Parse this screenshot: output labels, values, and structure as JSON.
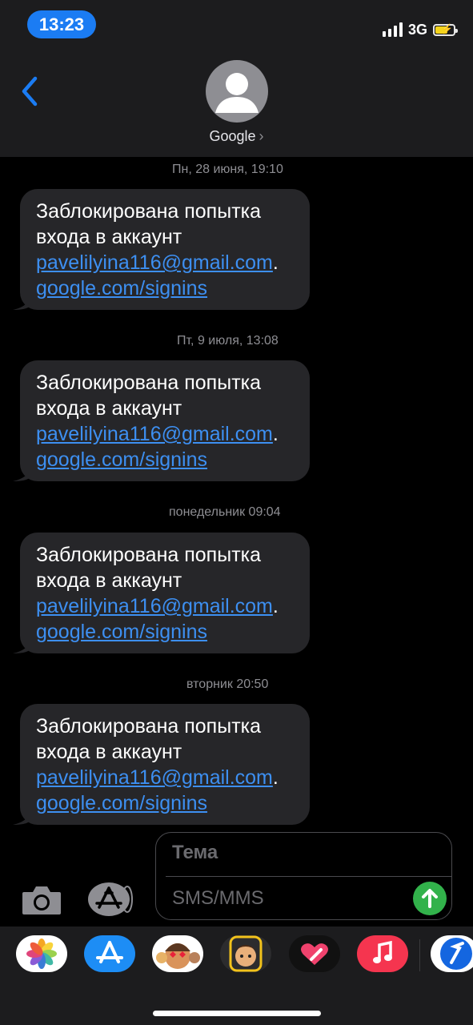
{
  "status": {
    "time": "13:23",
    "network": "3G"
  },
  "contact": {
    "name": "Google"
  },
  "messages": [
    {
      "timestamp": "Пн, 28 июня, 19:10",
      "line1": "Заблокирована попытка",
      "line2": "входа в аккаунт",
      "email": "pavelilyina116@gmail.com",
      "dot": ".",
      "link": "google.com/signins"
    },
    {
      "timestamp": "Пт, 9 июля, 13:08",
      "line1": "Заблокирована попытка",
      "line2": "входа в аккаунт",
      "email": "pavelilyina116@gmail.com",
      "dot": ".",
      "link": "google.com/signins"
    },
    {
      "timestamp": "понедельник 09:04",
      "line1": "Заблокирована попытка",
      "line2": "входа в аккаунт",
      "email": "pavelilyina116@gmail.com",
      "dot": ".",
      "link": "google.com/signins"
    },
    {
      "timestamp": "вторник 20:50",
      "line1": "Заблокирована попытка",
      "line2": "входа в аккаунт",
      "email": "pavelilyina116@gmail.com",
      "dot": ".",
      "link": "google.com/signins"
    }
  ],
  "composer": {
    "subject_placeholder": "Тема",
    "message_placeholder": "SMS/MMS"
  },
  "apps": [
    "photos-app-icon",
    "app-store-icon",
    "memoji-stickers-icon",
    "memoji-icon",
    "digital-touch-icon",
    "music-icon",
    "shazam-icon"
  ],
  "colors": {
    "accent": "#1b7cf3",
    "link": "#3d8ff1",
    "bubble": "#262629",
    "send": "#32b24b"
  }
}
